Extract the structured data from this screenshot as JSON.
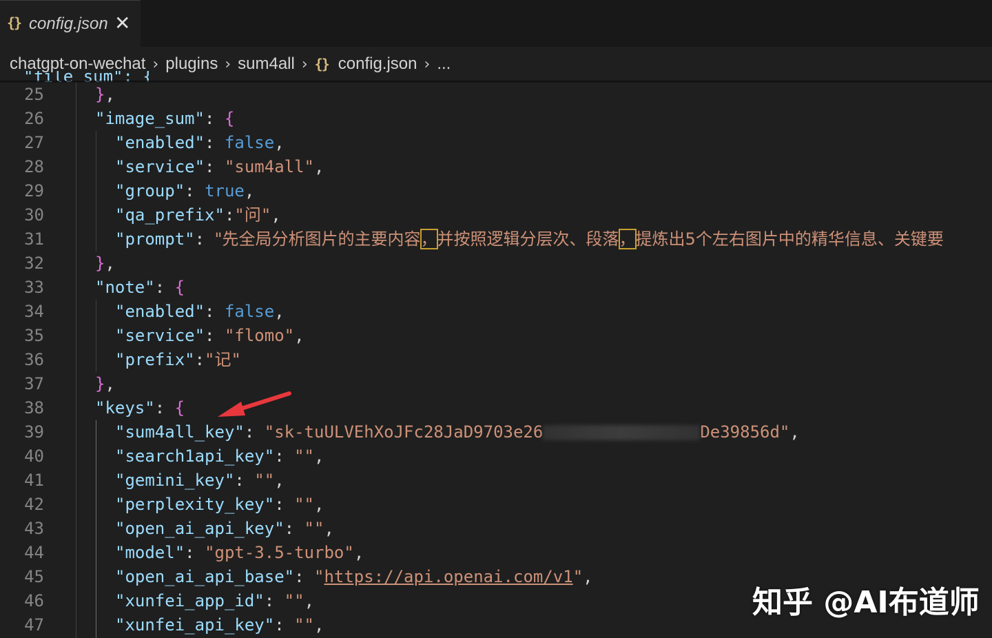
{
  "tab": {
    "icon": "json-braces-icon",
    "icon_glyph": "{}",
    "label": "config.json",
    "close": "✕"
  },
  "breadcrumb": {
    "items": [
      "chatgpt-on-wechat",
      "plugins",
      "sum4all",
      "config.json",
      "..."
    ],
    "separator": "›"
  },
  "editor": {
    "peek_text": "\"file_sum\": {",
    "line_numbers": [
      "25",
      "26",
      "27",
      "28",
      "29",
      "30",
      "31",
      "32",
      "33",
      "34",
      "35",
      "36",
      "37",
      "38",
      "39",
      "40",
      "41",
      "42",
      "43",
      "44",
      "45",
      "46",
      "47"
    ],
    "l25": {
      "close": "}",
      "comma": ","
    },
    "l26": {
      "key": "\"image_sum\"",
      "colon": ": ",
      "open": "{"
    },
    "l27": {
      "key": "\"enabled\"",
      "colon": ": ",
      "val": "false",
      "comma": ","
    },
    "l28": {
      "key": "\"service\"",
      "colon": ": ",
      "val": "\"sum4all\"",
      "comma": ","
    },
    "l29": {
      "key": "\"group\"",
      "colon": ": ",
      "val": "true",
      "comma": ","
    },
    "l30": {
      "key": "\"qa_prefix\"",
      "colon": ":",
      "val": "\"问\"",
      "comma": ","
    },
    "l31": {
      "key": "\"prompt\"",
      "colon": ": ",
      "val_a": "\"先全局分析图片的主要内容",
      "hl1": "，",
      "val_b": "并按照逻辑分层次、段落",
      "hl2": "，",
      "val_c": "提炼出5个左右图片中的精华信息、关键要"
    },
    "l32": {
      "close": "}",
      "comma": ","
    },
    "l33": {
      "key": "\"note\"",
      "colon": ": ",
      "open": "{"
    },
    "l34": {
      "key": "\"enabled\"",
      "colon": ": ",
      "val": "false",
      "comma": ","
    },
    "l35": {
      "key": "\"service\"",
      "colon": ": ",
      "val": "\"flomo\"",
      "comma": ","
    },
    "l36": {
      "key": "\"prefix\"",
      "colon": ":",
      "val": "\"记\""
    },
    "l37": {
      "close": "}",
      "comma": ","
    },
    "l38": {
      "key": "\"keys\"",
      "colon": ": ",
      "open": "{"
    },
    "l39": {
      "key": "\"sum4all_key\"",
      "colon": ": ",
      "val_a": "\"sk-tuULVEhXoJFc28JaD9703e26",
      "val_b": "De39856d\"",
      "comma": ","
    },
    "l40": {
      "key": "\"search1api_key\"",
      "colon": ": ",
      "val": "\"\"",
      "comma": ","
    },
    "l41": {
      "key": "\"gemini_key\"",
      "colon": ": ",
      "val": "\"\"",
      "comma": ","
    },
    "l42": {
      "key": "\"perplexity_key\"",
      "colon": ": ",
      "val": "\"\"",
      "comma": ","
    },
    "l43": {
      "key": "\"open_ai_api_key\"",
      "colon": ": ",
      "val": "\"\"",
      "comma": ","
    },
    "l44": {
      "key": "\"model\"",
      "colon": ": ",
      "val": "\"gpt-3.5-turbo\"",
      "comma": ","
    },
    "l45": {
      "key": "\"open_ai_api_base\"",
      "colon": ": ",
      "q1": "\"",
      "url": "https://api.openai.com/v1",
      "q2": "\"",
      "comma": ","
    },
    "l46": {
      "key": "\"xunfei_app_id\"",
      "colon": ": ",
      "val": "\"\"",
      "comma": ","
    },
    "l47": {
      "key": "\"xunfei_api_key\"",
      "colon": ": ",
      "val": "\"\"",
      "comma": ","
    }
  },
  "watermark": "知乎 @AI布道师",
  "colors": {
    "background": "#1f1f1f",
    "key": "#9cdcfe",
    "string": "#ce9178",
    "boolean": "#569cd6",
    "arrow": "#e8383d"
  }
}
